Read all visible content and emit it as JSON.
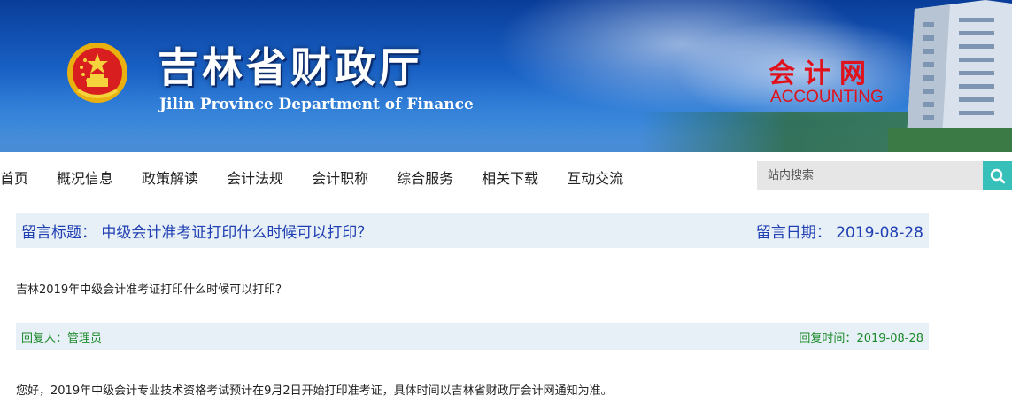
{
  "header": {
    "title_cn": "吉林省财政厅",
    "title_en": "Jilin Province Department of Finance",
    "site_name": "会计网",
    "site_name_en": "ACCOUNTING"
  },
  "nav": {
    "items": [
      "首页",
      "概况信息",
      "政策解读",
      "会计法规",
      "会计职称",
      "综合服务",
      "相关下载",
      "互动交流"
    ]
  },
  "search": {
    "placeholder": "站内搜索",
    "icon": "search-icon",
    "button_color": "#37c0b9"
  },
  "message": {
    "title_label": "留言标题：",
    "title": "中级会计准考证打印什么时候可以打印？",
    "date_label": "留言日期：",
    "date": "2019-08-28",
    "body": "吉林2019年中级会计准考证打印什么时候可以打印？"
  },
  "reply": {
    "replier_label": "回复人：",
    "replier": "管理员",
    "time_label": "回复时间：",
    "time": "2019-08-28",
    "body": "您好，2019年中级会计专业技术资格考试预计在9月2日开始打印准考证，具体时间以吉林省财政厅会计网通知为准。"
  },
  "colors": {
    "title_blue": "#1f3fb2",
    "reply_green": "#1a8a2a",
    "panel_bg": "#e8f0f7",
    "accent_red": "#e0121b"
  }
}
